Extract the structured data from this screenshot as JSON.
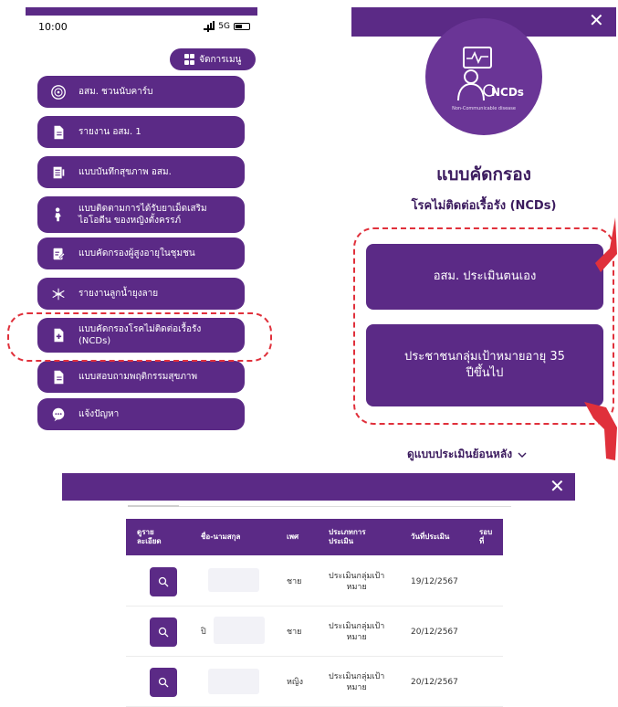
{
  "status": {
    "time": "10:00",
    "network": "5G"
  },
  "menu_manage_label": "จัดการเมนู",
  "menu": [
    {
      "label": "อสม. ชวนนับคาร์บ",
      "icon": "carb-icon"
    },
    {
      "label": "รายงาน อสม. 1",
      "icon": "document-icon"
    },
    {
      "label": "แบบบันทึกสุขภาพ อสม.",
      "icon": "health-record-icon"
    },
    {
      "label": "แบบติดตามการได้รับยาเม็ดเสริม\nไอโอดีน ของหญิงตั้งครรภ์",
      "icon": "pregnant-icon"
    },
    {
      "label": "แบบคัดกรองผู้สูงอายุในชุมชน",
      "icon": "elderly-screening-icon"
    },
    {
      "label": "รายงานลูกน้ำยุงลาย",
      "icon": "mosquito-icon"
    },
    {
      "label": "แบบคัดกรองโรคไม่ติดต่อเรื้อรัง\n(NCDs)",
      "icon": "ncd-add-icon"
    },
    {
      "label": "แบบสอบถามพฤติกรรมสุขภาพ",
      "icon": "questionnaire-icon"
    },
    {
      "label": "แจ้งปัญหา",
      "icon": "report-problem-icon"
    }
  ],
  "ncd": {
    "logo_text": "NCDs",
    "logo_subtext": "Non-Communicable disease",
    "title": "แบบคัดกรอง",
    "subtitle": "โรคไม่ติดต่อเรื้อรัง (NCDs)",
    "option1": "อสม. ประเมินตนเอง",
    "option2": "ประชาชนกลุ่มเป้าหมายอายุ 35\nปีขึ้นไป",
    "history_link": "ดูแบบประเมินย้อนหลัง"
  },
  "table": {
    "headers": [
      "ดูราย\nละเอียด",
      "ชื่อ-นามสกุล",
      "เพศ",
      "ประเภทการ\nประเมิน",
      "วันที่ประเมิน",
      "รอบ\nที่"
    ],
    "rows": [
      {
        "name": "",
        "gender": "ชาย",
        "type": "ประเมินกลุ่มเป้า\nหมาย",
        "date": "19/12/2567"
      },
      {
        "name": "ปิ",
        "gender": "ชาย",
        "type": "ประเมินกลุ่มเป้า\nหมาย",
        "date": "20/12/2567"
      },
      {
        "name": "",
        "gender": "หญิง",
        "type": "ประเมินกลุ่มเป้า\nหมาย",
        "date": "20/12/2567"
      }
    ]
  },
  "colors": {
    "primary": "#5b2a86",
    "accent_red": "#e0303b",
    "title_text": "#3b1a5e"
  }
}
